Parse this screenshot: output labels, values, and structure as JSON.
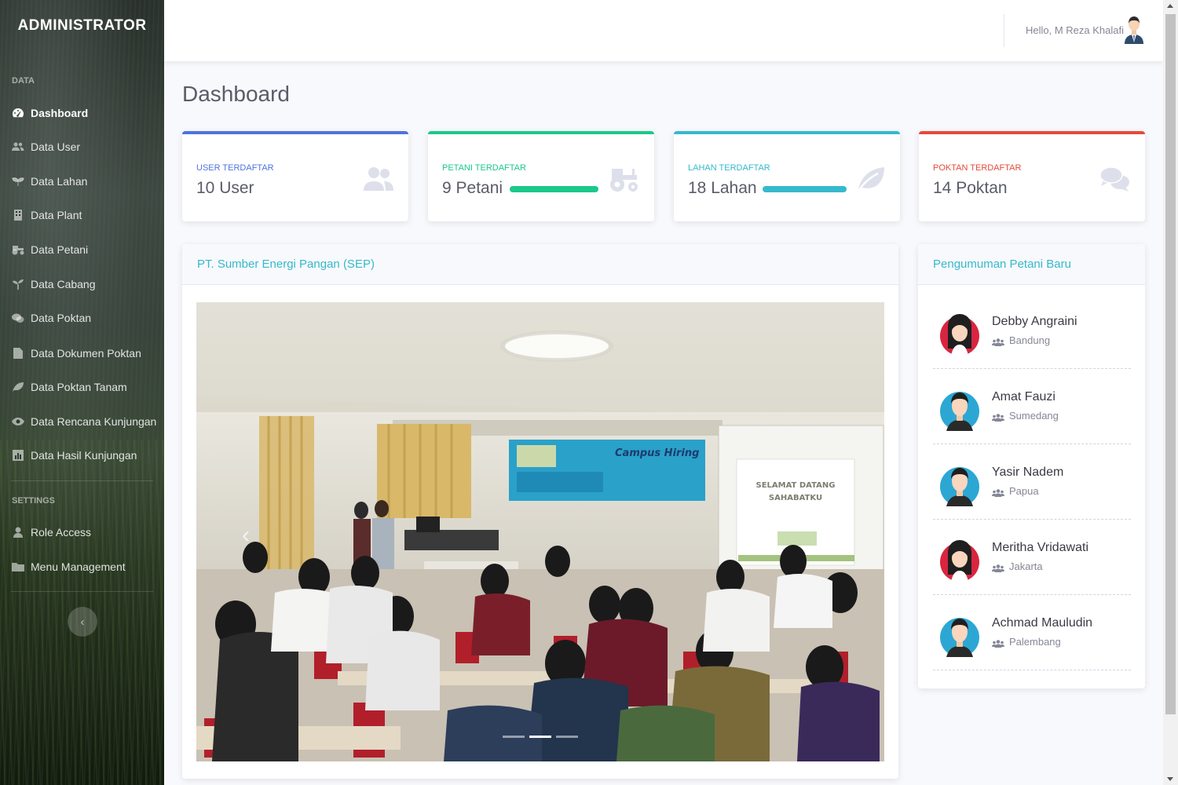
{
  "app": {
    "brand": "ADMINISTRATOR",
    "user_greeting": "Hello, M Reza Khalafi"
  },
  "sidebar": {
    "heading_data": "DATA",
    "heading_settings": "SETTINGS",
    "items": [
      {
        "label": "Dashboard",
        "icon": "tachometer-icon"
      },
      {
        "label": "Data User",
        "icon": "users-icon"
      },
      {
        "label": "Data Lahan",
        "icon": "seedling-icon"
      },
      {
        "label": "Data Plant",
        "icon": "building-icon"
      },
      {
        "label": "Data Petani",
        "icon": "tractor-icon"
      },
      {
        "label": "Data Cabang",
        "icon": "sprout-icon"
      },
      {
        "label": "Data Poktan",
        "icon": "comments-icon"
      },
      {
        "label": "Data Dokumen Poktan",
        "icon": "file-icon"
      },
      {
        "label": "Data Poktan Tanam",
        "icon": "leaf-icon"
      },
      {
        "label": "Data Rencana Kunjungan",
        "icon": "eye-icon"
      },
      {
        "label": "Data Hasil Kunjungan",
        "icon": "chart-icon"
      }
    ],
    "settings_items": [
      {
        "label": "Role Access",
        "icon": "user-icon"
      },
      {
        "label": "Menu Management",
        "icon": "folder-icon"
      }
    ]
  },
  "page": {
    "title": "Dashboard"
  },
  "stats": [
    {
      "label": "USER TERDAFTAR",
      "value": "10 User",
      "color": "#4e73df",
      "icon": "users-icon"
    },
    {
      "label": "PETANI TERDAFTAR",
      "value": "9 Petani",
      "color": "#1cc88a",
      "icon": "tractor-icon"
    },
    {
      "label": "LAHAN TERDAFTAR",
      "value": "18 Lahan",
      "color": "#36b9cc",
      "icon": "leaf-icon"
    },
    {
      "label": "POKTAN TERDAFTAR",
      "value": "14 Poktan",
      "color": "#e74a3b",
      "icon": "comments-icon"
    }
  ],
  "company_card": {
    "title": "PT. Sumber Energi Pangan (SEP)",
    "banner_title": "Campus Hiring",
    "screen_text_1": "SELAMAT DATANG",
    "screen_text_2": "SAHABATKU",
    "active_slide": 2,
    "slide_count": 3
  },
  "announcements": {
    "title": "Pengumuman Petani Baru",
    "items": [
      {
        "name": "Debby Angraini",
        "location": "Bandung",
        "gender": "female"
      },
      {
        "name": "Amat Fauzi",
        "location": "Sumedang",
        "gender": "male"
      },
      {
        "name": "Yasir Nadem",
        "location": "Papua",
        "gender": "male"
      },
      {
        "name": "Meritha Vridawati",
        "location": "Jakarta",
        "gender": "female"
      },
      {
        "name": "Achmad Mauludin",
        "location": "Palembang",
        "gender": "male"
      }
    ]
  },
  "colors": {
    "primary": "#4e73df",
    "success": "#1cc88a",
    "info": "#36b9cc",
    "danger": "#e74a3b"
  }
}
